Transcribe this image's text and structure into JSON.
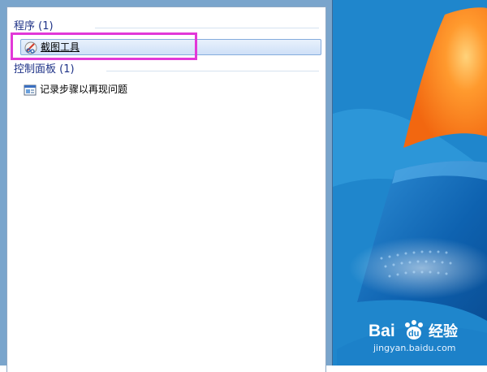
{
  "search_results": {
    "programs": {
      "header": "程序 (1)",
      "items": [
        {
          "label": "截图工具",
          "icon": "snipping-tool-icon",
          "selected": true
        }
      ]
    },
    "control_panel": {
      "header": "控制面板 (1)",
      "items": [
        {
          "label": "记录步骤以再现问题",
          "icon": "steps-recorder-icon",
          "selected": false
        }
      ]
    }
  },
  "watermark": {
    "logo_text": "Bai du 经验",
    "url": "jingyan.baidu.com"
  },
  "colors": {
    "group_header_text": "#1e3287",
    "selection_fill": "#d7e6f9",
    "annotation_box": "#e238d8",
    "desktop_blue": "#1f86cc",
    "windows_orange": "#f47b1c"
  }
}
